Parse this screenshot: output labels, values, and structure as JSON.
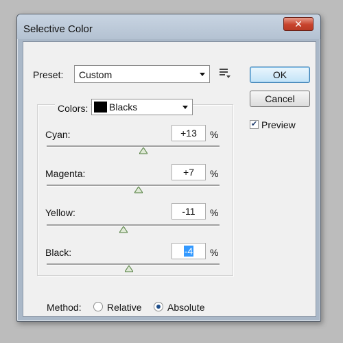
{
  "window": {
    "title": "Selective Color",
    "close_symbol": "✕"
  },
  "preset": {
    "label": "Preset:",
    "value": "Custom"
  },
  "buttons": {
    "ok": "OK",
    "cancel": "Cancel"
  },
  "preview": {
    "label": "Preview",
    "checked": true
  },
  "colors": {
    "label": "Colors:",
    "value": "Blacks",
    "swatch_color": "#000000"
  },
  "sliders": [
    {
      "label": "Cyan:",
      "value": "+13",
      "unit": "%"
    },
    {
      "label": "Magenta:",
      "value": "+7",
      "unit": "%"
    },
    {
      "label": "Yellow:",
      "value": "-11",
      "unit": "%"
    },
    {
      "label": "Black:",
      "value": "-4",
      "unit": "%"
    }
  ],
  "method": {
    "label": "Method:",
    "options": [
      {
        "label": "Relative",
        "selected": false
      },
      {
        "label": "Absolute",
        "selected": true
      }
    ]
  }
}
